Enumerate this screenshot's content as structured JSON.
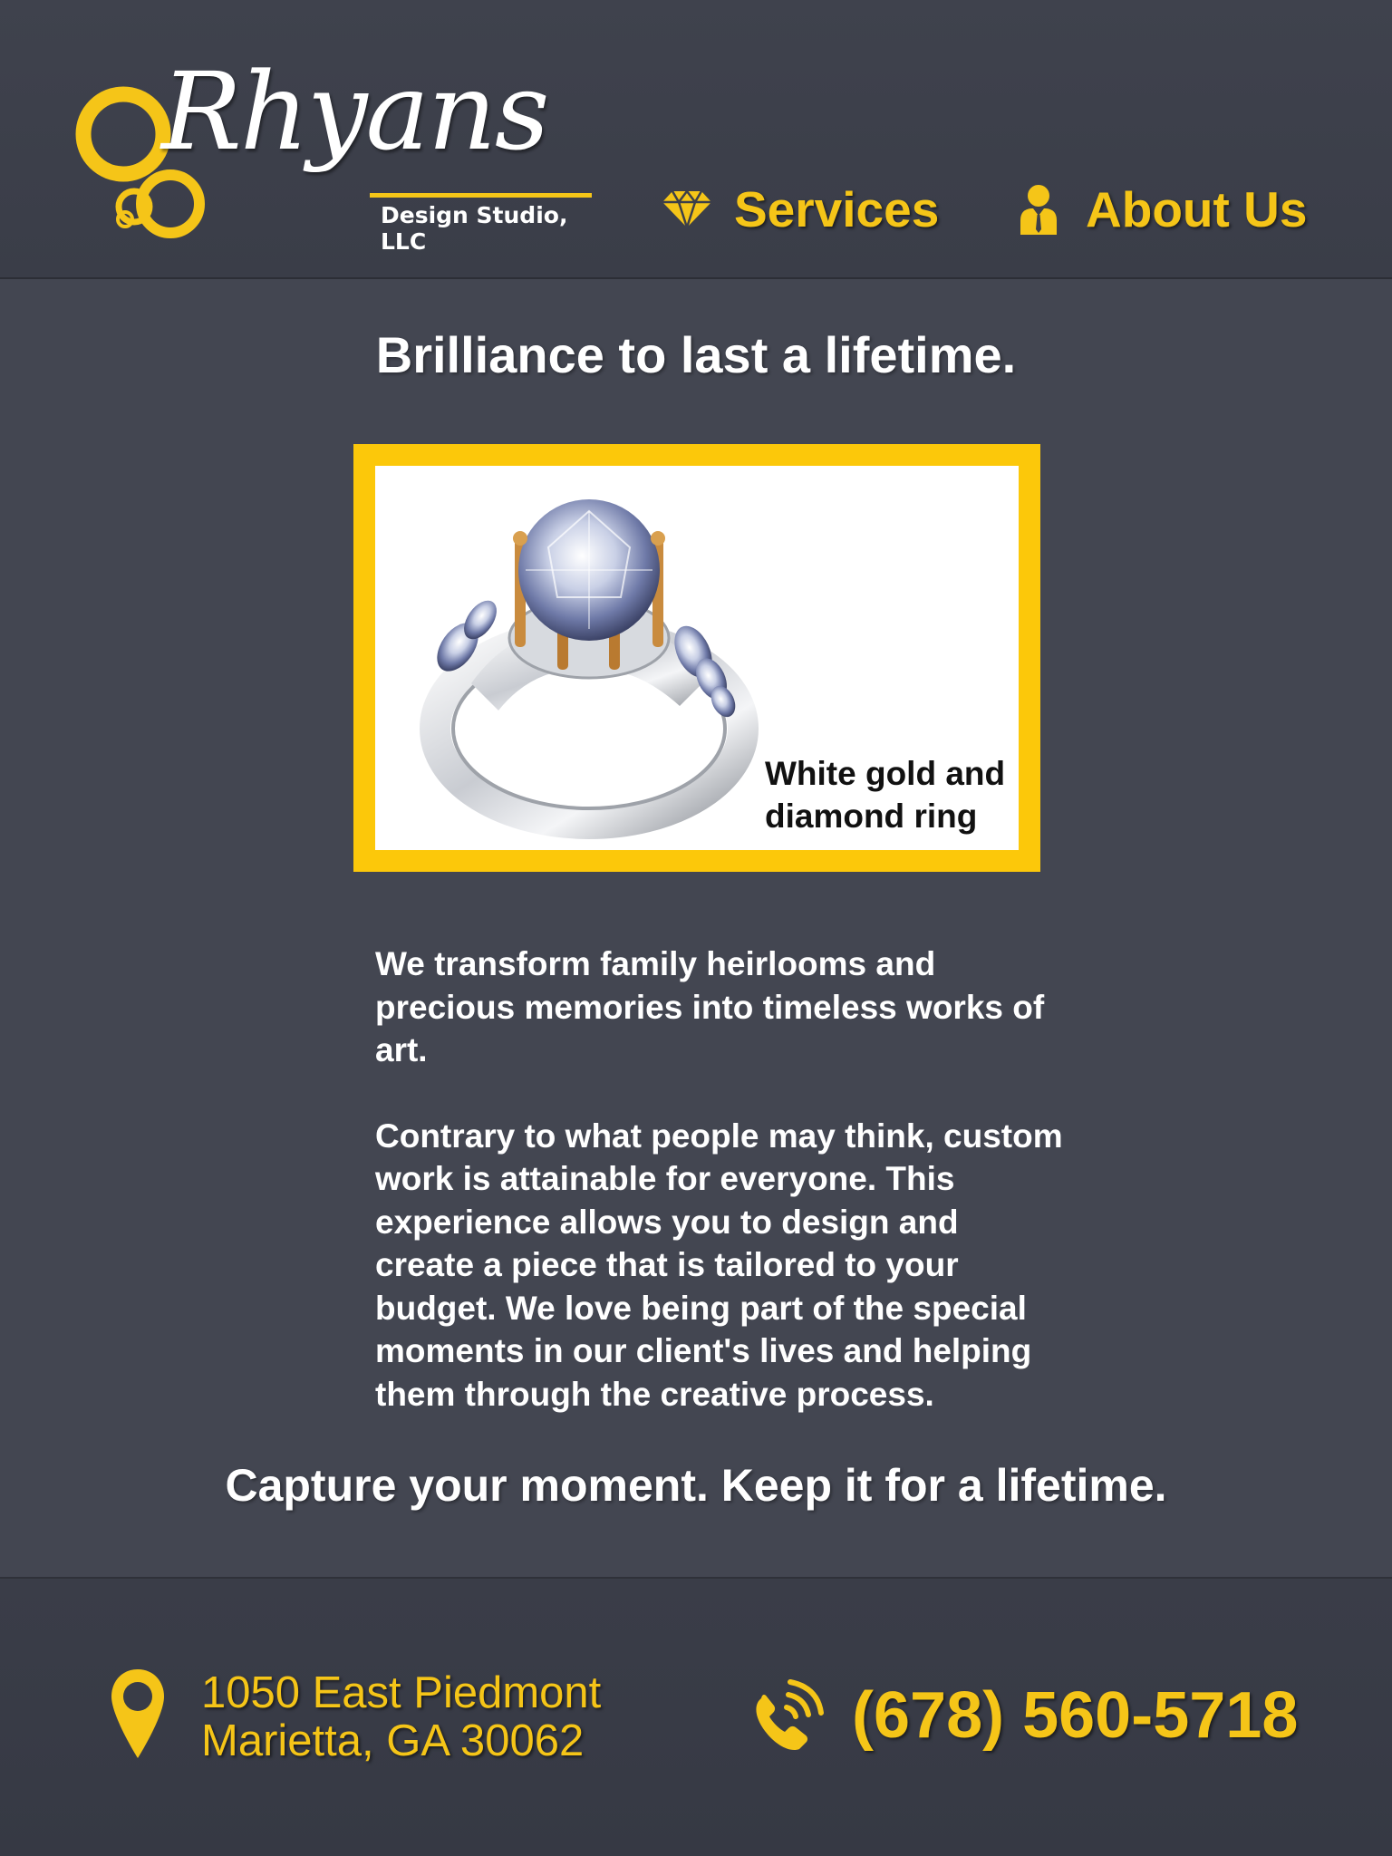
{
  "header": {
    "logo": {
      "name": "Rhyans",
      "tagline": "Design Studio, LLC"
    },
    "nav": [
      {
        "label": "Services",
        "icon": "diamond-icon"
      },
      {
        "label": "About Us",
        "icon": "person-icon"
      }
    ]
  },
  "main": {
    "headline": "Brilliance to last a lifetime.",
    "featured": {
      "caption": "White gold and diamond ring",
      "image": "ring-image"
    },
    "paragraphs": [
      "We transform family heirlooms and precious memories into timeless works of art.",
      "Contrary to what people may think, custom work is attainable for everyone. This experience allows you to design and create a piece that is tailored to your budget. We love being part of the special moments in our client's lives and helping them through the creative process."
    ],
    "tagline": "Capture your moment. Keep it for a lifetime."
  },
  "footer": {
    "address_line1": "1050 East Piedmont",
    "address_line2": "Marietta, GA 30062",
    "address_icon": "map-pin-icon",
    "phone": "(678) 560-5718",
    "phone_icon": "phone-icon"
  },
  "colors": {
    "background": "#434651",
    "header_footer": "#3a3d48",
    "accent": "#f5c518",
    "frame": "#fcc80a",
    "text": "#ffffff"
  }
}
